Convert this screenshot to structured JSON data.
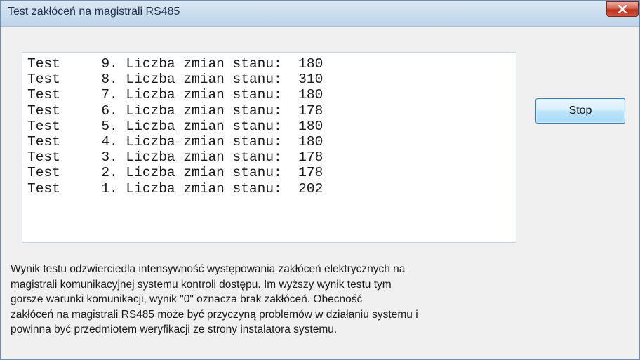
{
  "window": {
    "title": "Test zakłóceń na magistrali RS485",
    "close_icon": "close-icon"
  },
  "log": {
    "lines": [
      "Test     9. Liczba zmian stanu:  180",
      "Test     8. Liczba zmian stanu:  310",
      "Test     7. Liczba zmian stanu:  180",
      "Test     6. Liczba zmian stanu:  178",
      "Test     5. Liczba zmian stanu:  180",
      "Test     4. Liczba zmian stanu:  180",
      "Test     3. Liczba zmian stanu:  178",
      "Test     2. Liczba zmian stanu:  178",
      "Test     1. Liczba zmian stanu:  202"
    ]
  },
  "buttons": {
    "stop_label": "Stop"
  },
  "description": {
    "lines": [
      "Wynik testu odzwierciedla intensywność występowania zakłóceń elektrycznych na",
      "magistrali komunikacyjnej systemu kontroli dostępu. Im wyższy wynik testu tym",
      "gorsze warunki komunikacji, wynik \"0\" oznacza brak zakłóceń. Obecność",
      "zakłóceń na magistrali RS485 może być przyczyną problemów w działaniu systemu i",
      "powinna być przedmiotem weryfikacji ze strony instalatora systemu."
    ]
  },
  "colors": {
    "close_button": "#c0321d",
    "stop_button_border": "#3c7fb1",
    "titlebar": "#cddfef"
  }
}
